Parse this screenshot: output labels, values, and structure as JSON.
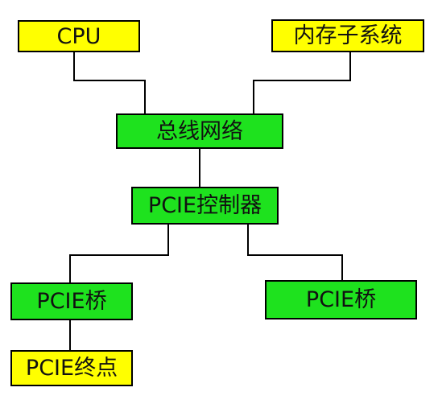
{
  "nodes": {
    "cpu": {
      "label": "CPU"
    },
    "memory_subsystem": {
      "label": "内存子系统"
    },
    "bus_network": {
      "label": "总线网络"
    },
    "pcie_controller": {
      "label": "PCIE控制器"
    },
    "pcie_bridge_left": {
      "label": "PCIE桥"
    },
    "pcie_bridge_right": {
      "label": "PCIE桥"
    },
    "pcie_endpoint": {
      "label": "PCIE终点"
    }
  },
  "colors": {
    "yellow_fill": "#ffff00",
    "green_fill": "#1ee21e",
    "border": "#000000",
    "line": "#000000"
  }
}
